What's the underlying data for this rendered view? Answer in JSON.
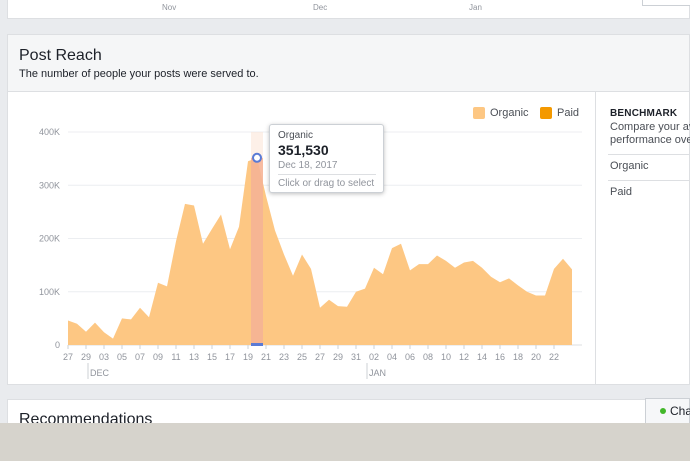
{
  "top_axis": {
    "ticks": [
      "Nov",
      "Dec",
      "Jan"
    ]
  },
  "post_reach": {
    "title": "Post Reach",
    "subtitle": "The number of people your posts were served to."
  },
  "legend": {
    "organic": "Organic",
    "paid": "Paid"
  },
  "colors": {
    "organic": "#fdc783",
    "paid": "#f49900",
    "highlight": "#f4a98a",
    "marker": "#5b7bd5"
  },
  "benchmark": {
    "title": "BENCHMARK",
    "description_line1": "Compare your average",
    "description_line2": "performance over",
    "rows": [
      "Organic",
      "Paid"
    ]
  },
  "tooltip": {
    "series": "Organic",
    "value": "351,530",
    "date": "Dec 18, 2017",
    "hint": "Click or drag to select"
  },
  "chart_data": {
    "type": "area",
    "series": [
      {
        "name": "Organic",
        "values": [
          46000,
          40000,
          25000,
          42000,
          24000,
          12000,
          50000,
          48000,
          70000,
          52000,
          117000,
          110000,
          195000,
          265000,
          262000,
          190000,
          218000,
          245000,
          180000,
          222000,
          345000,
          351530,
          280000,
          215000,
          170000,
          130000,
          170000,
          143000,
          70000,
          85000,
          73000,
          72000,
          100000,
          106000,
          145000,
          133000,
          182000,
          190000,
          140000,
          152000,
          152000,
          168000,
          158000,
          145000,
          155000,
          158000,
          145000,
          128000,
          118000,
          125000,
          112000,
          100000,
          93000,
          93000,
          143000,
          162000,
          142000
        ]
      },
      {
        "name": "Paid",
        "values": []
      }
    ],
    "x_ticks": [
      "27",
      "29",
      "03",
      "05",
      "07",
      "09",
      "11",
      "13",
      "15",
      "17",
      "19",
      "21",
      "23",
      "25",
      "27",
      "29",
      "31",
      "02",
      "04",
      "06",
      "08",
      "10",
      "12",
      "14",
      "16",
      "18",
      "20",
      "22"
    ],
    "month_labels": [
      "DEC",
      "JAN"
    ],
    "y_ticks": [
      "0",
      "100K",
      "200K",
      "300K",
      "400K"
    ],
    "ylim": [
      0,
      400000
    ],
    "grid": true,
    "legend_position": "top-right",
    "highlighted_index": 21
  },
  "recommendations": {
    "title": "Recommendations"
  },
  "chat": {
    "label": "Chat"
  }
}
